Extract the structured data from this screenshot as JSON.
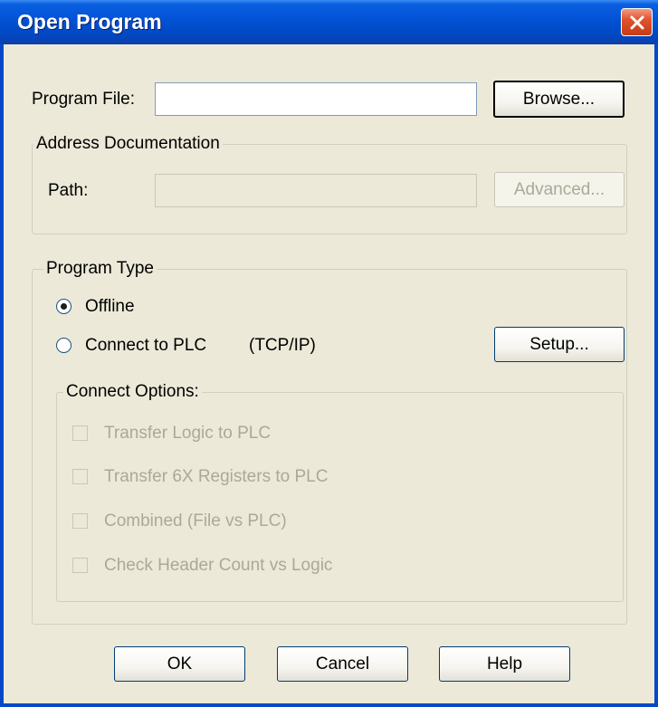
{
  "window": {
    "title": "Open Program"
  },
  "program_file": {
    "label": "Program File:",
    "value": "",
    "browse_label": "Browse..."
  },
  "address_documentation": {
    "legend": "Address Documentation",
    "path_label": "Path:",
    "path_value": "",
    "advanced_label": "Advanced..."
  },
  "program_type": {
    "legend": "Program Type",
    "offline_label": "Offline",
    "offline_selected": true,
    "connect_label": "Connect to PLC",
    "connect_protocol": "(TCP/IP)",
    "setup_label": "Setup..."
  },
  "connect_options": {
    "legend": "Connect Options:",
    "items": [
      {
        "label": "Transfer Logic to PLC",
        "checked": false
      },
      {
        "label": "Transfer 6X Registers to PLC",
        "checked": false
      },
      {
        "label": "Combined (File vs PLC)",
        "checked": false
      },
      {
        "label": "Check Header Count vs Logic",
        "checked": false
      }
    ]
  },
  "footer": {
    "ok_label": "OK",
    "cancel_label": "Cancel",
    "help_label": "Help"
  },
  "colors": {
    "titlebar": "#0252d6",
    "face": "#ece9d8",
    "disabled_text": "#aca899",
    "close_button": "#e0522d"
  }
}
